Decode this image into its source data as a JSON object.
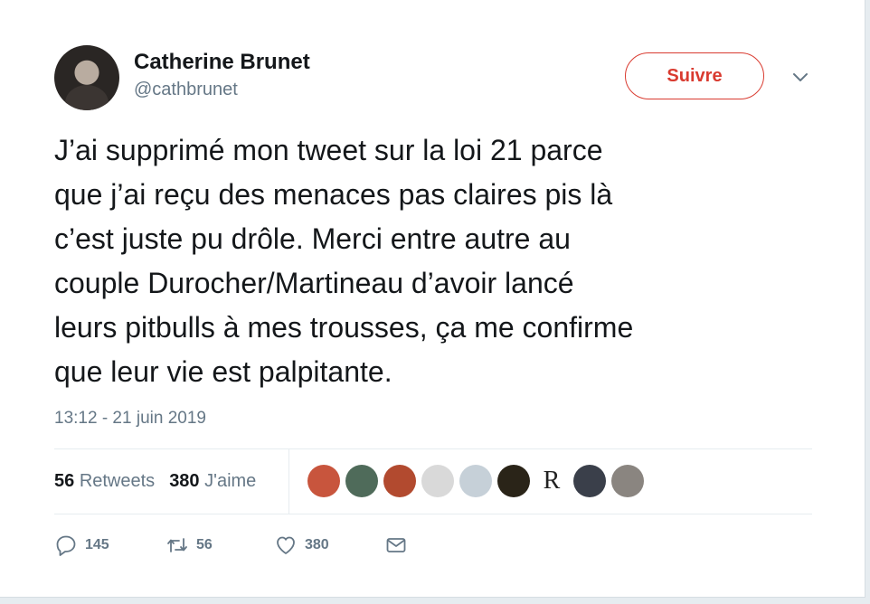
{
  "author": {
    "name": "Catherine Brunet",
    "handle": "@cathbrunet"
  },
  "follow_label": "Suivre",
  "tweet": {
    "text": "J’ai supprimé mon tweet sur la loi 21 parce\nque j’ai reçu des menaces pas claires pis là\nc’est juste pu drôle. Merci entre autre au\ncouple Durocher/Martineau d’avoir lancé\nleurs pitbulls à mes trousses, ça me confirme\nque leur vie est palpitante.",
    "timestamp": "13:12 - 21 juin 2019"
  },
  "stats": {
    "retweets_count": "56",
    "retweets_label": "Retweets",
    "likes_count": "380",
    "likes_label": "J'aime"
  },
  "likers": [
    {
      "name": "liker-1",
      "color": "#c8553d"
    },
    {
      "name": "liker-2",
      "color": "#4f6b5a"
    },
    {
      "name": "liker-3",
      "color": "#b24a2f"
    },
    {
      "name": "liker-4",
      "color": "#d9d9d9"
    },
    {
      "name": "liker-5",
      "color": "#c6d0d8"
    },
    {
      "name": "liker-6",
      "color": "#2a2418"
    },
    {
      "name": "liker-7",
      "color": "#ffffff",
      "letter": "R"
    },
    {
      "name": "liker-8",
      "color": "#3a3f4a"
    },
    {
      "name": "liker-9",
      "color": "#8a8580"
    }
  ],
  "actions": {
    "replies": "145",
    "retweets": "56",
    "likes": "380"
  },
  "colors": {
    "accent": "#d93b30",
    "secondary_text": "#657786",
    "divider": "#e6ecf0"
  }
}
